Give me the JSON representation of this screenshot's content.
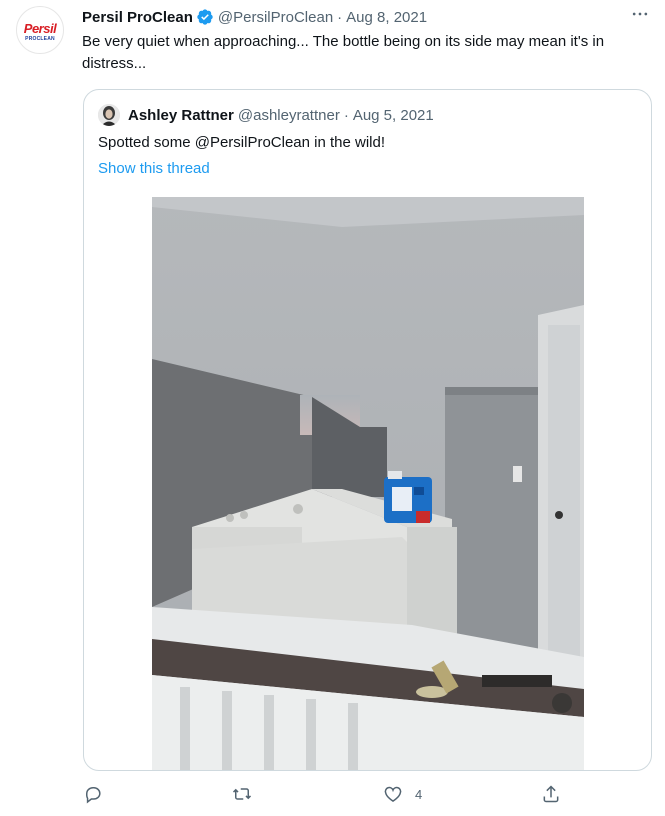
{
  "tweet": {
    "author": {
      "name": "Persil ProClean",
      "handle": "@PersilProClean",
      "avatar_brand": "Persil",
      "avatar_sub": "PROCLEAN"
    },
    "separator": "·",
    "date": "Aug 8, 2021",
    "text": "Be very quiet when approaching... The bottle being on its side may mean it's in distress...",
    "more_icon": "more-horizontal-icon"
  },
  "quoted_tweet": {
    "author": {
      "name": "Ashley Rattner",
      "handle": "@ashleyrattner"
    },
    "separator": "·",
    "date": "Aug 5, 2021",
    "text": "Spotted some @PersilProClean in the wild!",
    "show_thread": "Show this thread"
  },
  "actions": {
    "reply": {
      "icon": "reply-icon",
      "count": ""
    },
    "retweet": {
      "icon": "retweet-icon",
      "count": ""
    },
    "like": {
      "icon": "heart-icon",
      "count": "4"
    },
    "share": {
      "icon": "share-icon",
      "count": ""
    }
  },
  "colors": {
    "link": "#1d9bf0",
    "verified": "#1d9bf0",
    "muted": "#536471",
    "border": "#cfd9de",
    "brand_red": "#d81e25"
  }
}
